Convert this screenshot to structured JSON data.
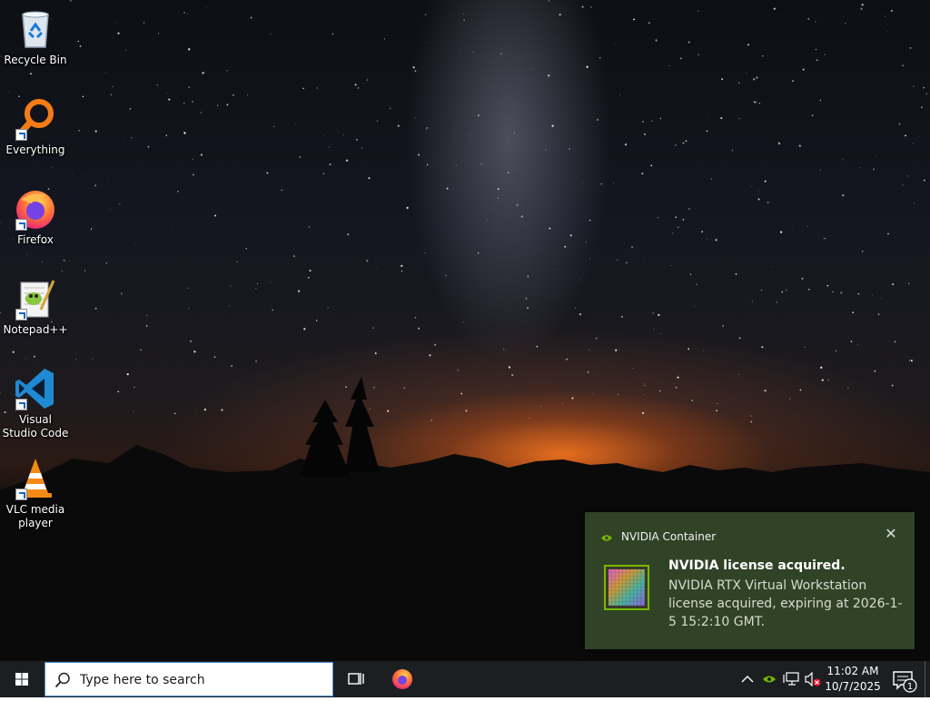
{
  "desktop": {
    "icons": [
      {
        "label": "Recycle Bin",
        "icon": "recycle-bin-icon"
      },
      {
        "label": "Everything",
        "icon": "everything-search-icon"
      },
      {
        "label": "Firefox",
        "icon": "firefox-icon"
      },
      {
        "label": "Notepad++",
        "icon": "notepadpp-icon"
      },
      {
        "label": "Visual Studio Code",
        "icon": "vscode-icon"
      },
      {
        "label": "VLC media player",
        "icon": "vlc-icon"
      }
    ]
  },
  "notification": {
    "app_name": "NVIDIA Container",
    "title": "NVIDIA license acquired.",
    "body": "NVIDIA RTX Virtual Workstation license acquired, expiring at 2026-1-5 15:2:10 GMT.",
    "close_glyph": "✕",
    "accent": "#76b900"
  },
  "taskbar": {
    "search_placeholder": "Type here to search",
    "clock_time": "11:02 AM",
    "clock_date": "10/7/2025",
    "notification_count": "1",
    "tray_chevron": "^"
  },
  "colors": {
    "taskbar_bg": "#1c1f22",
    "toast_bg": "#34482a",
    "windows_blue": "#0078d7"
  }
}
